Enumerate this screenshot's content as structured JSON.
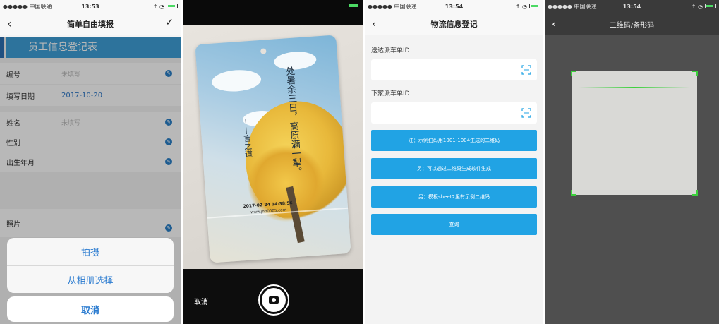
{
  "screen1": {
    "status": {
      "carrier": "●●●●● 中国联通",
      "time": "13:53"
    },
    "nav": {
      "title": "简单自由填报"
    },
    "section_title": "员工信息登记表",
    "fields": [
      {
        "label": "编号",
        "value": "未填写"
      },
      {
        "label": "填写日期",
        "value": "2017-10-20"
      },
      {
        "label": "姓名",
        "value": "未填写"
      },
      {
        "label": "性别",
        "value": ""
      },
      {
        "label": "出生年月",
        "value": ""
      },
      {
        "label": "照片",
        "value": ""
      }
    ],
    "action_sheet": {
      "take_photo": "拍摄",
      "from_album": "从相册选择",
      "cancel": "取消"
    }
  },
  "screen2": {
    "card": {
      "poem": "处暑余三日，高原满一犁。",
      "signature": "——言之道",
      "date": "2017-02-24 14:38:56",
      "url": "www.jnb0005.com"
    },
    "cancel": "取消"
  },
  "screen3": {
    "status": {
      "carrier": "●●●●● 中国联通",
      "time": "13:54"
    },
    "nav": {
      "title": "物流信息登记"
    },
    "field1_label": "送达派车单ID",
    "field2_label": "下家派车单ID",
    "buttons": [
      "注：示例扫码用1001-1004生成的二维码",
      "另：可以通过二维码生成软件生成",
      "另：模板sheet2里有示例二维码",
      "查询"
    ]
  },
  "screen4": {
    "status": {
      "carrier": "●●●●● 中国联通",
      "time": "13:54"
    },
    "nav": {
      "title": "二维码/条形码"
    }
  },
  "colors": {
    "accent_blue": "#21a3e4",
    "scan_green": "#3cd03c",
    "sheet_text": "#2a7bd0"
  }
}
